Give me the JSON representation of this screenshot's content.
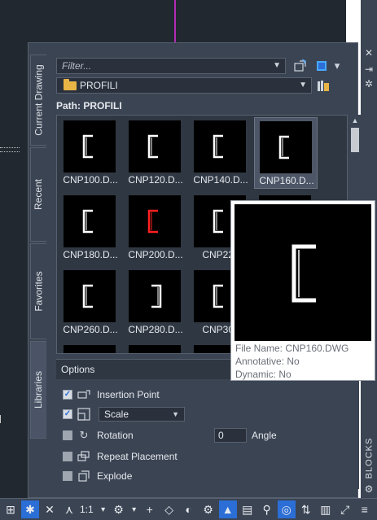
{
  "colors": {
    "panel": "#3b4453",
    "selection": "#2b6ed6",
    "folder": "#e8b445",
    "accent_red": "#ff2020"
  },
  "side_tabs": [
    "Current Drawing",
    "Recent",
    "Favorites",
    "Libraries"
  ],
  "active_tab": "Libraries",
  "filter": {
    "placeholder": "Filter..."
  },
  "folder": {
    "name": "PROFILI"
  },
  "path_label": "Path: PROFILI",
  "blocks": [
    {
      "label": "CNP100.D...",
      "selected": false
    },
    {
      "label": "CNP120.D...",
      "selected": false
    },
    {
      "label": "CNP140.D...",
      "selected": false
    },
    {
      "label": "CNP160.D...",
      "selected": true
    },
    {
      "label": "CNP180.D...",
      "selected": false
    },
    {
      "label": "CNP200.D...",
      "selected": false
    },
    {
      "label": "CNP220",
      "selected": false
    },
    {
      "label": "",
      "selected": false
    },
    {
      "label": "CNP260.D...",
      "selected": false
    },
    {
      "label": "CNP280.D...",
      "selected": false
    },
    {
      "label": "CNP300",
      "selected": false
    },
    {
      "label": "",
      "selected": false
    }
  ],
  "tooltip": {
    "file_name": "File Name: CNP160.DWG",
    "annotative": "Annotative: No",
    "dynamic": "Dynamic: No"
  },
  "options": {
    "title": "Options",
    "insertion_point": {
      "label": "Insertion Point",
      "checked": true
    },
    "scale": {
      "checked": true,
      "value": "Scale"
    },
    "rotation": {
      "label": "Rotation",
      "checked": false
    },
    "angle": {
      "value": "0",
      "label": "Angle"
    },
    "repeat_placement": {
      "label": "Repeat Placement",
      "checked": false
    },
    "explode": {
      "label": "Explode",
      "checked": false
    }
  },
  "blocks_tab_label": "BLOCKS",
  "statusbar": {
    "annotation_scale": "1:1"
  }
}
